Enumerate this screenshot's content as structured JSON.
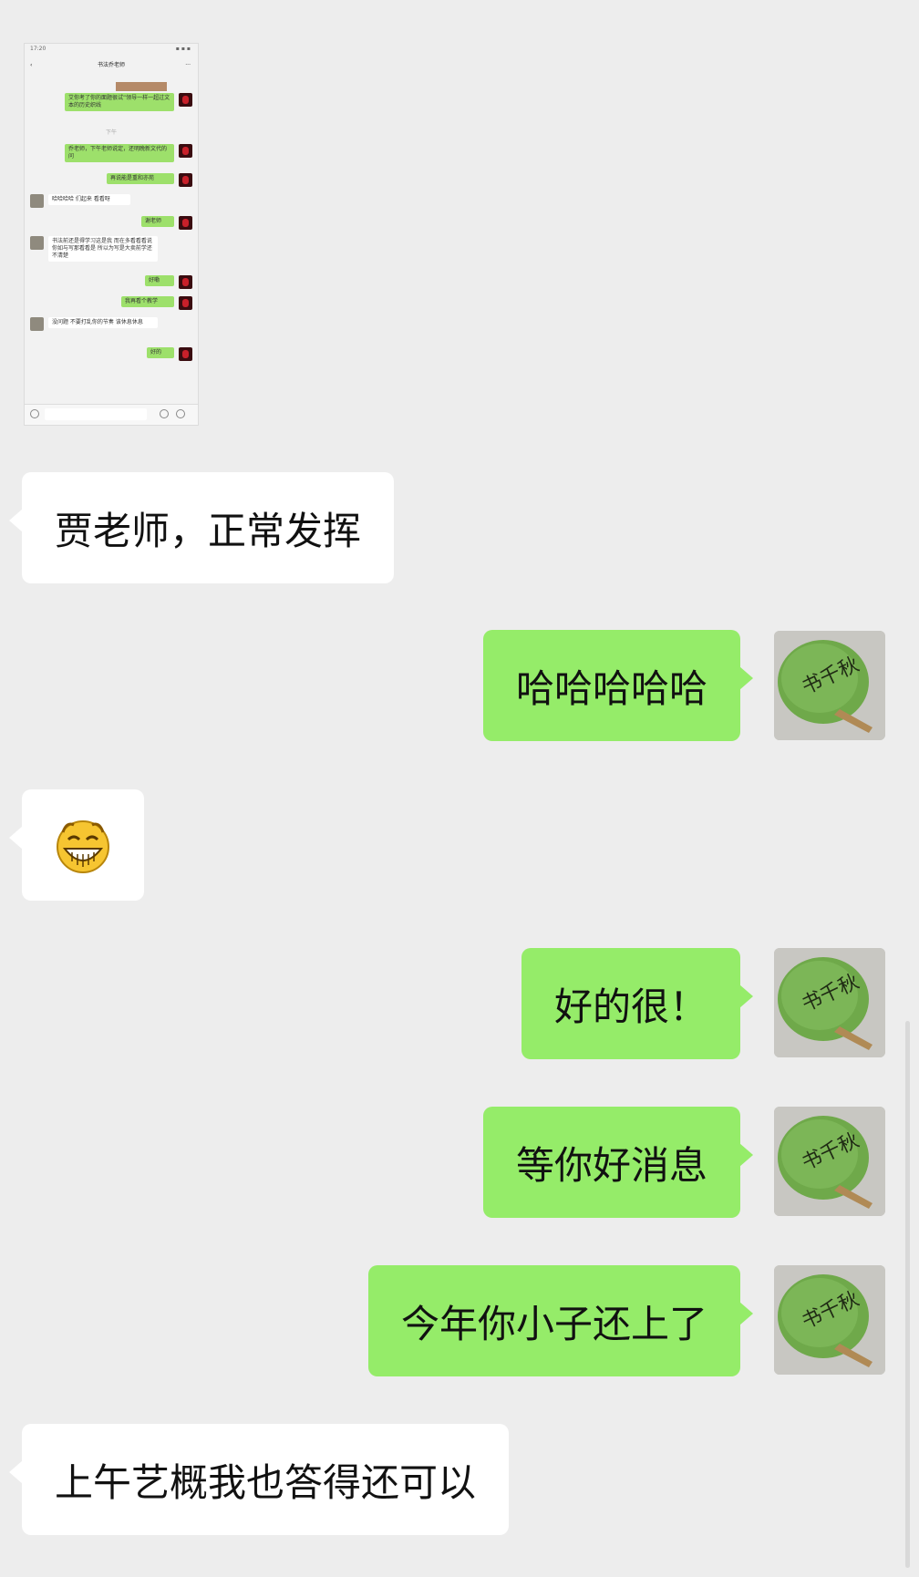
{
  "thumbnail": {
    "status_time": "17:20",
    "chat_title": "书法乔老师",
    "timestamp": "下午",
    "messages": [
      {
        "side": "sent",
        "text": "艾你考了你的面题很试”领导一样一超过文本的历史织线"
      },
      {
        "side": "sent",
        "text": "乔老师，下午老师说定，还明晚新文代的问"
      },
      {
        "side": "sent",
        "text": "再说能是重和亦苑"
      },
      {
        "side": "recv",
        "text": "哈哈哈哈 们起来 看看呀"
      },
      {
        "side": "sent",
        "text": "谢老师"
      },
      {
        "side": "recv",
        "text": "书法前还是得学习这是我 而在多看看看说 你如与写那看看是 所以为写是大卖前学还不清楚"
      },
      {
        "side": "sent",
        "text": "好嘞"
      },
      {
        "side": "sent",
        "text": "我再看个教学"
      },
      {
        "side": "recv",
        "text": "没问题 不要打乱你的节奏 该休息休息"
      },
      {
        "side": "sent",
        "text": "好的"
      }
    ]
  },
  "messages": [
    {
      "side": "recv",
      "text": "贾老师，正常发挥"
    },
    {
      "side": "sent",
      "text": "哈哈哈哈哈"
    },
    {
      "side": "recv",
      "emoji": "grin-emoji"
    },
    {
      "side": "sent",
      "text": "好的很！"
    },
    {
      "side": "sent",
      "text": "等你好消息"
    },
    {
      "side": "sent",
      "text": "今年你小子还上了"
    },
    {
      "side": "recv",
      "text": "上午艺概我也答得还可以"
    }
  ],
  "avatar_fan_text": "书千秋",
  "colors": {
    "sent_bubble": "#95ec69",
    "recv_bubble": "#ffffff",
    "background": "#ededed"
  }
}
